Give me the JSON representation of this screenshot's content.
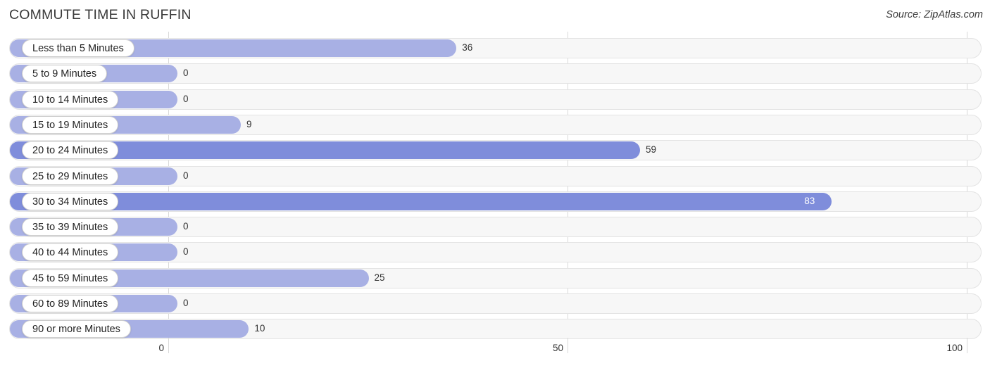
{
  "header": {
    "title": "COMMUTE TIME IN RUFFIN",
    "source": "Source: ZipAtlas.com"
  },
  "colors": {
    "bar_light": "#a8b0e4",
    "bar_dark": "#7f8ddb",
    "track_fill": "#f7f7f7",
    "track_border": "#e3e3e3",
    "gridline": "#d8d8d8",
    "text": "#333333"
  },
  "chart_data": {
    "type": "bar",
    "orientation": "horizontal",
    "title": "COMMUTE TIME IN RUFFIN",
    "xlabel": "",
    "ylabel": "",
    "xlim": [
      0,
      100
    ],
    "ticks": [
      "0",
      "50",
      "100"
    ],
    "tick_values": [
      0,
      50,
      100
    ],
    "grid": true,
    "legend": false,
    "categories": [
      "Less than 5 Minutes",
      "5 to 9 Minutes",
      "10 to 14 Minutes",
      "15 to 19 Minutes",
      "20 to 24 Minutes",
      "25 to 29 Minutes",
      "30 to 34 Minutes",
      "35 to 39 Minutes",
      "40 to 44 Minutes",
      "45 to 59 Minutes",
      "60 to 89 Minutes",
      "90 or more Minutes"
    ],
    "values": [
      36,
      0,
      0,
      9,
      59,
      0,
      83,
      0,
      0,
      25,
      0,
      10
    ],
    "value_labels": [
      "36",
      "0",
      "0",
      "9",
      "59",
      "0",
      "83",
      "0",
      "0",
      "25",
      "0",
      "10"
    ]
  }
}
